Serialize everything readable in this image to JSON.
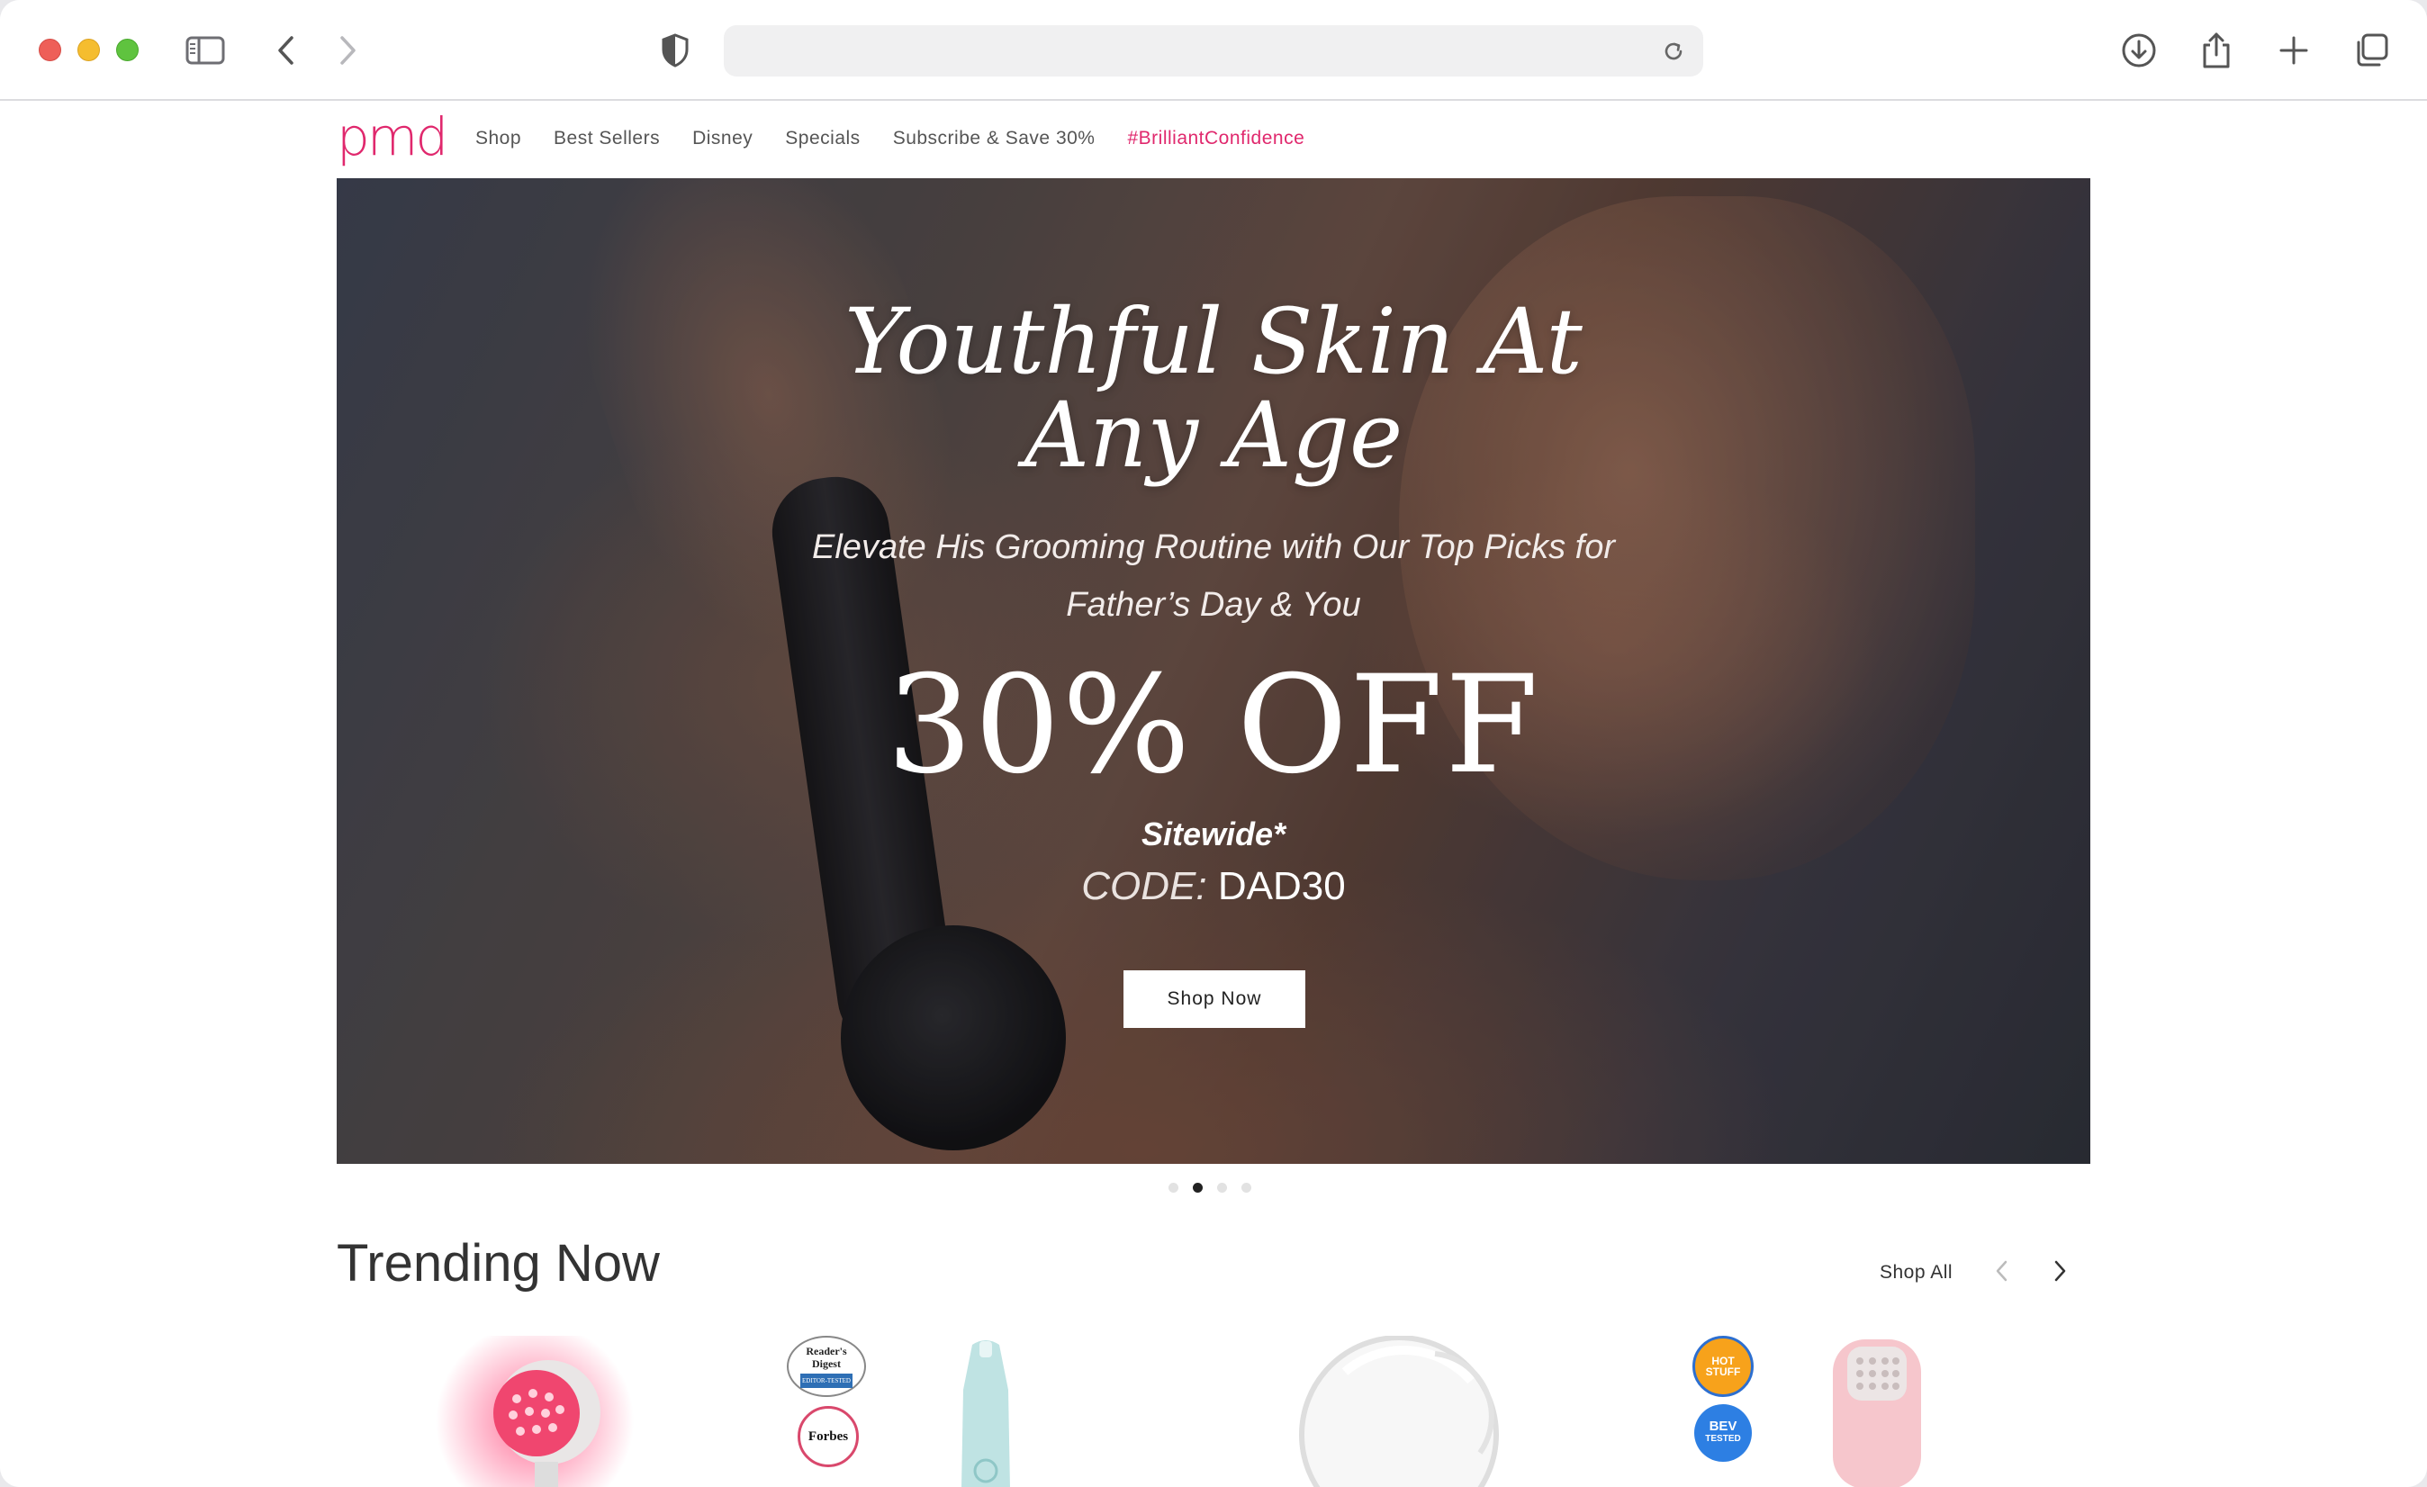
{
  "browser": {
    "url_value": "",
    "icons": [
      "sidebar-icon",
      "back-icon",
      "forward-icon",
      "shield-icon",
      "reload-icon",
      "download-icon",
      "share-icon",
      "new-tab-icon",
      "tabs-icon"
    ]
  },
  "site": {
    "logo": "pmd",
    "nav": [
      {
        "label": "Shop"
      },
      {
        "label": "Best Sellers"
      },
      {
        "label": "Disney"
      },
      {
        "label": "Specials"
      },
      {
        "label": "Subscribe & Save 30%"
      },
      {
        "label": "#BrilliantConfidence"
      }
    ],
    "accent_color": "#e0286d"
  },
  "hero": {
    "title_line1": "Youthful Skin At",
    "title_line2": "Any Age",
    "subtitle_line1": "Elevate His Grooming Routine with Our Top Picks for",
    "subtitle_line2": "Father’s Day & You",
    "discount": "30% OFF",
    "scope": "Sitewide*",
    "code_label": "CODE:",
    "code_value": "DAD30",
    "button": "Shop Now",
    "slides_total": 4,
    "active_slide": 2
  },
  "trending": {
    "title": "Trending Now",
    "shop_all": "Shop All",
    "badges": {
      "readers_digest_line1": "Reader's",
      "readers_digest_line2": "Digest",
      "readers_digest_tag": "EDITOR-TESTED",
      "forbes": "Forbes",
      "hot_stuff": "HOT STUFF",
      "bev": "BEV",
      "bev_tested": "TESTED"
    }
  }
}
